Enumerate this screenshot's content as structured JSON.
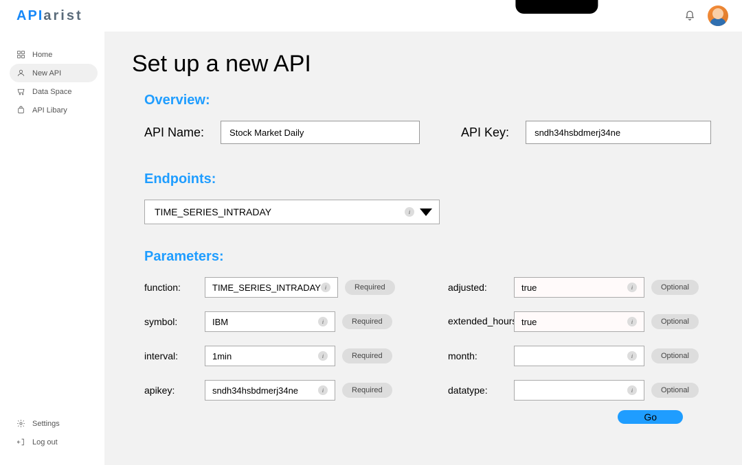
{
  "brand": {
    "prefix": "AP",
    "mid": "I",
    "suffix": "arist"
  },
  "sidebar": {
    "items": [
      {
        "label": "Home"
      },
      {
        "label": "New API"
      },
      {
        "label": "Data Space"
      },
      {
        "label": "API Libary"
      }
    ],
    "footer": [
      {
        "label": "Settings"
      },
      {
        "label": "Log out"
      }
    ]
  },
  "page_title": "Set up a new API",
  "sections": {
    "overview": "Overview:",
    "endpoints": "Endpoints:",
    "parameters": "Parameters:"
  },
  "overview": {
    "name_label": "API Name:",
    "name_value": "Stock Market Daily",
    "key_label": "API Key:",
    "key_value": "sndh34hsbdmerj34ne"
  },
  "endpoint": {
    "selected": "TIME_SERIES_INTRADAY"
  },
  "params": {
    "left": [
      {
        "label": "function:",
        "value": "TIME_SERIES_INTRADAY",
        "badge": "Required"
      },
      {
        "label": "symbol:",
        "value": "IBM",
        "badge": "Required"
      },
      {
        "label": "interval:",
        "value": "1min",
        "badge": "Required"
      },
      {
        "label": "apikey:",
        "value": "sndh34hsbdmerj34ne",
        "badge": "Required"
      }
    ],
    "right": [
      {
        "label": "adjusted:",
        "value": "true",
        "badge": "Optional",
        "tint": true
      },
      {
        "label": "extended_hours:",
        "value": "true",
        "badge": "Optional",
        "tint": true
      },
      {
        "label": "month:",
        "value": "",
        "badge": "Optional"
      },
      {
        "label": "datatype:",
        "value": "",
        "badge": "Optional"
      }
    ]
  },
  "go_label": "Go",
  "info_glyph": "i"
}
